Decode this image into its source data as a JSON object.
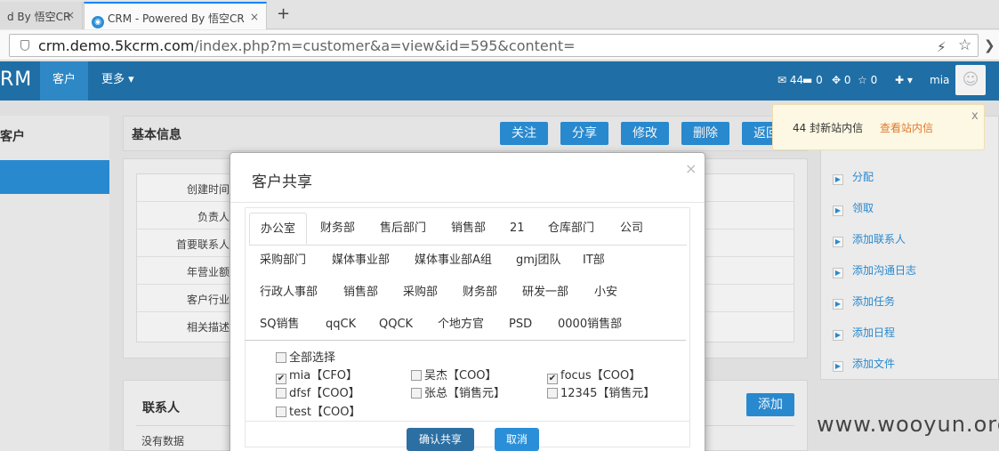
{
  "browser": {
    "tabs": [
      {
        "label": "d By 悟空CR",
        "active": false
      },
      {
        "label": "CRM - Powered By 悟空CR",
        "active": true
      }
    ],
    "close_glyph": "×",
    "new_tab_glyph": "+",
    "url_host": "crm.demo.5kcrm.com",
    "url_path": "/index.php?m=customer&a=view&id=595&content="
  },
  "nav": {
    "brand": "RM",
    "items": [
      "客户",
      "更多 ▾"
    ],
    "messages_count": "44",
    "stat2": "0",
    "stat3": "0",
    "stat4": "0",
    "plus": "✚ ▾",
    "user": "mia"
  },
  "left": {
    "title": "客户"
  },
  "main": {
    "section_title": "基本信息",
    "buttons": [
      "关注",
      "分享",
      "修改",
      "删除",
      "返回"
    ],
    "info_labels": [
      "创建时间",
      "负责人",
      "首要联系人",
      "年营业额",
      "客户行业",
      "相关描述"
    ],
    "contacts_title": "联系人",
    "contacts_add": "添加",
    "contacts_empty": "没有数据"
  },
  "right": {
    "items": [
      "分配",
      "领取",
      "添加联系人",
      "添加沟通日志",
      "添加任务",
      "添加日程",
      "添加文件"
    ]
  },
  "notice": {
    "count": "44",
    "text": "封新站内信",
    "link": "查看站内信",
    "close": "x"
  },
  "modal": {
    "title": "客户共享",
    "close": "×",
    "dept_rows": [
      [
        "办公室",
        "财务部",
        "售后部门",
        "销售部",
        "21",
        "仓库部门",
        "公司"
      ],
      [
        "采购部门",
        "媒体事业部",
        "媒体事业部A组",
        "gmj团队",
        "IT部"
      ],
      [
        "行政人事部",
        "销售部",
        "采购部",
        "财务部",
        "研发一部",
        "小安"
      ],
      [
        "SQ销售",
        "qqCK",
        "QQCK",
        "个地方官",
        "PSD",
        "0000销售部"
      ]
    ],
    "select_all": "全部选择",
    "users": [
      {
        "name": "mia【CFO】",
        "checked": true
      },
      {
        "name": "吴杰【COO】",
        "checked": false
      },
      {
        "name": "focus【COO】",
        "checked": true
      },
      {
        "name": "dfsf【COO】",
        "checked": false
      },
      {
        "name": "张总【销售元】",
        "checked": false
      },
      {
        "name": "12345【销售元】",
        "checked": false
      },
      {
        "name": "test【COO】",
        "checked": false
      }
    ],
    "confirm": "确认共享",
    "cancel": "取消"
  },
  "watermark": "www.wooyun.org",
  "colors": {
    "primary": "#2a8fd8",
    "nav": "#1f6fa6",
    "confirm": "#2c6fa3",
    "link": "#e07a2f"
  }
}
